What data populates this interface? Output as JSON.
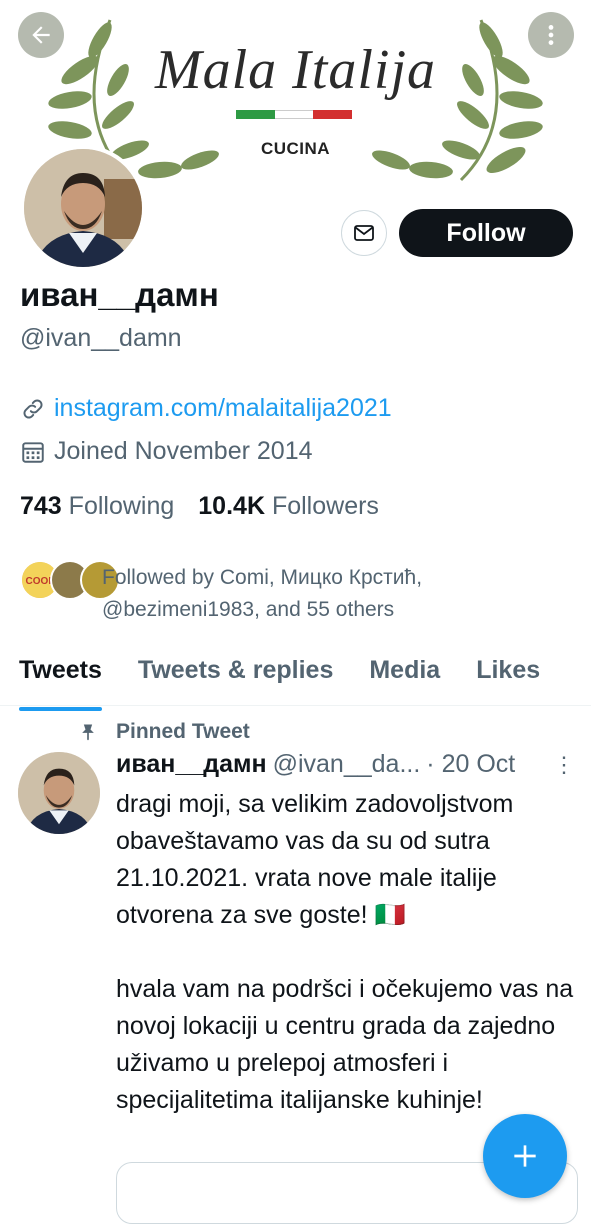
{
  "banner": {
    "title": "Mala Italija",
    "subtitle": "CUCINA",
    "flag_colors": [
      "#2e9a44",
      "#ffffff",
      "#d32f2f"
    ]
  },
  "header_icons": {
    "back": "arrow-left-icon",
    "more": "more-vertical-icon"
  },
  "profile": {
    "display_name": "иван__дамн",
    "handle": "@ivan__damn",
    "website": "instagram.com/malaitalija2021",
    "joined": "Joined November 2014",
    "following_count": "743",
    "following_label": "Following",
    "followers_count": "10.4K",
    "followers_label": "Followers",
    "followed_by_line1": "Followed by Comi, Мицко Крстић,",
    "followed_by_line2": "@bezimeni1983, and 55 others"
  },
  "actions": {
    "follow_label": "Follow",
    "message_icon": "envelope-icon"
  },
  "tabs": [
    {
      "label": "Tweets",
      "active": true
    },
    {
      "label": "Tweets & replies",
      "active": false
    },
    {
      "label": "Media",
      "active": false
    },
    {
      "label": "Likes",
      "active": false
    }
  ],
  "pinned_tweet": {
    "pinned_label": "Pinned Tweet",
    "author_name": "иван__дамн",
    "author_handle": "@ivan__da...",
    "date": "· 20 Oct",
    "text": "dragi moji, sa velikim zadovoljstvom obaveštavamo vas da su od sutra 21.10.2021. vrata nove male italije otvorena za sve goste! 🇮🇹\n\nhvala vam na podršci i očekujemo vas na novoj lokaciji u centru grada da zajedno uživamo u prelepoj atmosferi i specijalitetima italijanske kuhinje!"
  },
  "fab": {
    "icon": "plus-icon"
  },
  "colors": {
    "accent": "#1d9bf0",
    "text": "#0f1419",
    "muted": "#536471"
  }
}
